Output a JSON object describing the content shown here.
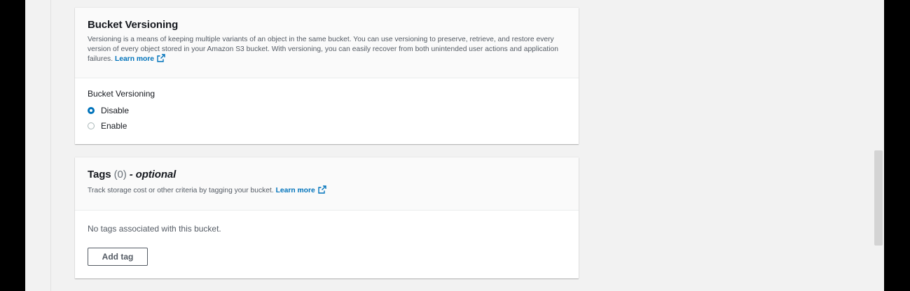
{
  "versioning_panel": {
    "title": "Bucket Versioning",
    "description": "Versioning is a means of keeping multiple variants of an object in the same bucket. You can use versioning to preserve, retrieve, and restore every version of every object stored in your Amazon S3 bucket. With versioning, you can easily recover from both unintended user actions and application failures.",
    "learn_more": "Learn more",
    "field_label": "Bucket Versioning",
    "options": [
      {
        "label": "Disable",
        "selected": true
      },
      {
        "label": "Enable",
        "selected": false
      }
    ]
  },
  "tags_panel": {
    "title": "Tags",
    "count": "(0)",
    "optional": "- optional",
    "description": "Track storage cost or other criteria by tagging your bucket.",
    "learn_more": "Learn more",
    "empty_text": "No tags associated with this bucket.",
    "add_button": "Add tag"
  },
  "colors": {
    "link": "#0073bb",
    "radio_selected": "#0073bb",
    "page_background": "#f2f2f2"
  },
  "icons": {
    "external_link": "external-link-icon"
  }
}
